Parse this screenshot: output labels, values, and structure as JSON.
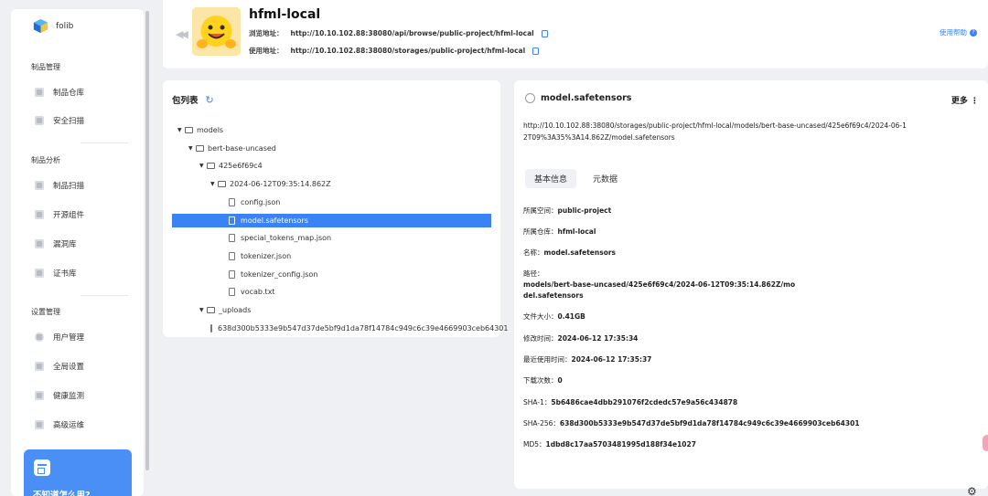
{
  "sidebar": {
    "brand": "folib",
    "groups": [
      {
        "title": "制品管理",
        "items": [
          "制品仓库",
          "安全扫描"
        ]
      },
      {
        "title": "制品分析",
        "items": [
          "制品扫描",
          "开源组件",
          "漏洞库",
          "证书库"
        ]
      },
      {
        "title": "设置管理",
        "items": [
          "用户管理",
          "全局设置",
          "健康监测",
          "高级运维"
        ]
      }
    ],
    "help_card": "不知道怎么用?"
  },
  "header": {
    "title": "hfml-local",
    "browse_label": "浏览地址：",
    "browse_url": "http://10.10.102.88:38080/api/browse/public-project/hfml-local",
    "usage_label": "使用地址：",
    "usage_url": "http://10.10.102.88:38080/storages/public-project/hfml-local",
    "help_link": "使用帮助"
  },
  "tree": {
    "title": "包列表",
    "rows": [
      {
        "label": "models",
        "type": "folder",
        "depth": 0,
        "expanded": true
      },
      {
        "label": "bert-base-uncased",
        "type": "folder",
        "depth": 1,
        "expanded": true
      },
      {
        "label": "425e6f69c4",
        "type": "folder",
        "depth": 2,
        "expanded": true
      },
      {
        "label": "2024-06-12T09:35:14.862Z",
        "type": "folder",
        "depth": 3,
        "expanded": true
      },
      {
        "label": "config.json",
        "type": "file",
        "depth": 4
      },
      {
        "label": "model.safetensors",
        "type": "file",
        "depth": 4,
        "selected": true
      },
      {
        "label": "special_tokens_map.json",
        "type": "file",
        "depth": 4
      },
      {
        "label": "tokenizer.json",
        "type": "file",
        "depth": 4
      },
      {
        "label": "tokenizer_config.json",
        "type": "file",
        "depth": 4
      },
      {
        "label": "vocab.txt",
        "type": "file",
        "depth": 4
      },
      {
        "label": "_uploads",
        "type": "folder",
        "depth": 2,
        "expanded": true
      },
      {
        "label": "638d300b5333e9b547d37de5bf9d1da78f14784c949c6c39e4669903ceb64301",
        "type": "file",
        "depth": 3
      }
    ]
  },
  "detail": {
    "title": "model.safetensors",
    "more": "更多",
    "url": "http://10.10.102.88:38080/storages/public-project/hfml-local/models/bert-base-uncased/425e6f69c4/2024-06-12T09%3A35%3A14.862Z/model.safetensors",
    "tabs": [
      "基本信息",
      "元数据"
    ],
    "fields": {
      "space_k": "所属空间：",
      "space_v": "public-project",
      "repo_k": "所属仓库：",
      "repo_v": "hfml-local",
      "name_k": "名称：",
      "name_v": "model.safetensors",
      "path_k": "路径：",
      "path_v1": "models/bert-base-uncased/425e6f69c4/2024-06-12T09:35:14.862Z/mo",
      "path_v2": "del.safetensors",
      "size_k": "文件大小：",
      "size_v": "0.41GB",
      "mtime_k": "修改时间：",
      "mtime_v": "2024-06-12 17:35:34",
      "lastuse_k": "最近使用时间：",
      "lastuse_v": "2024-06-12 17:35:37",
      "downloads_k": "下载次数：",
      "downloads_v": "0",
      "sha1_k": "SHA-1：",
      "sha1_v": "5b6486cae4dbb291076f2cdedc57e9a56c434878",
      "sha256_k": "SHA-256：",
      "sha256_v": "638d300b5333e9b547d37de5bf9d1da78f14784c949c6c39e4669903ceb64301",
      "md5_k": "MD5：",
      "md5_v": "1dbd8c17aa5703481995d188f34e1027"
    }
  },
  "colors": {
    "accent": "#3b82f6",
    "background": "#eef0f4"
  }
}
